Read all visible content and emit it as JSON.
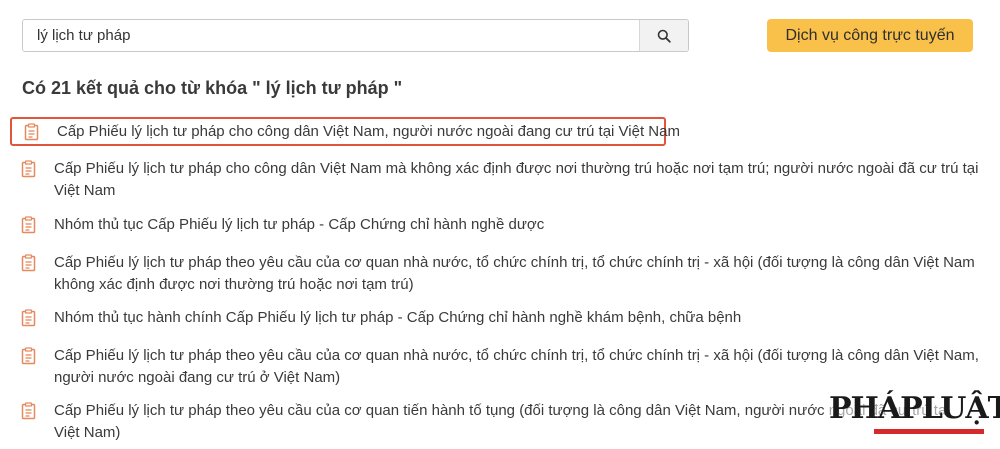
{
  "search": {
    "value": "lý lịch tư pháp",
    "button_icon": "search-icon"
  },
  "cta": {
    "label": "Dịch vụ công trực tuyến",
    "color": "#f9c04a"
  },
  "results": {
    "heading": "Có 21 kết quả cho từ khóa \" lý lịch tư pháp \"",
    "highlight_color": "#e1553a",
    "icon": "document-icon",
    "items": [
      {
        "text": "Cấp Phiếu lý lịch tư pháp cho công dân Việt Nam, người nước ngoài đang cư trú tại Việt Nam"
      },
      {
        "text": "Cấp Phiếu lý lịch tư pháp cho công dân Việt Nam mà không xác định được nơi thường trú hoặc nơi tạm trú; người nước ngoài đã cư trú tại Việt Nam"
      },
      {
        "text": "Nhóm thủ tục Cấp Phiếu lý lịch tư pháp - Cấp Chứng chỉ hành nghề dược"
      },
      {
        "text": "Cấp Phiếu lý lịch tư pháp theo yêu cầu của cơ quan nhà nước, tổ chức chính trị, tổ chức chính trị - xã hội (đối tượng là công dân Việt Nam không xác định được nơi thường trú hoặc nơi tạm trú)"
      },
      {
        "text": "Nhóm thủ tục hành chính Cấp Phiếu lý lịch tư pháp - Cấp Chứng chỉ hành nghề khám bệnh, chữa bệnh"
      },
      {
        "text": "Cấp Phiếu lý lịch tư pháp theo yêu cầu của cơ quan nhà nước, tổ chức chính trị, tổ chức chính trị - xã hội (đối tượng là công dân Việt Nam, người nước ngoài đang cư trú ở Việt Nam)"
      },
      {
        "text": "Cấp Phiếu lý lịch tư pháp theo yêu cầu của cơ quan tiến hành tố tụng (đối tượng là công dân Việt Nam, người nước ngoài đã cư trú tại Việt Nam)"
      }
    ]
  },
  "watermark": {
    "text": "PHÁPLUẬT",
    "accent_color": "#d62a2a"
  }
}
